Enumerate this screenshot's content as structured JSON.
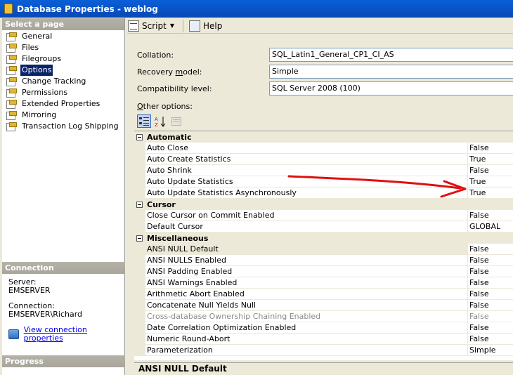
{
  "window": {
    "title": "Database Properties - weblog"
  },
  "left": {
    "select_page_heading": "Select a page",
    "pages": [
      {
        "label": "General",
        "name": "general"
      },
      {
        "label": "Files",
        "name": "files"
      },
      {
        "label": "Filegroups",
        "name": "filegroups"
      },
      {
        "label": "Options",
        "name": "options",
        "selected": true
      },
      {
        "label": "Change Tracking",
        "name": "change-tracking"
      },
      {
        "label": "Permissions",
        "name": "permissions"
      },
      {
        "label": "Extended Properties",
        "name": "extended-properties"
      },
      {
        "label": "Mirroring",
        "name": "mirroring"
      },
      {
        "label": "Transaction Log Shipping",
        "name": "transaction-log-shipping"
      }
    ],
    "connection_heading": "Connection",
    "server_label": "Server:",
    "server_value": "EMSERVER",
    "connection_label": "Connection:",
    "connection_value": "EMSERVER\\Richard",
    "view_connection_link": "View connection properties",
    "progress_heading": "Progress"
  },
  "toolbar": {
    "script_label": "Script",
    "help_label": "Help"
  },
  "form": {
    "collation_label": "Collation:",
    "collation_value": "SQL_Latin1_General_CP1_CI_AS",
    "recovery_label_pre": "Recovery ",
    "recovery_label_ul": "m",
    "recovery_label_post": "odel:",
    "recovery_value": "Simple",
    "compat_label": "Compatibility level:",
    "compat_value": "SQL Server 2008 (100)",
    "other_label_ul": "O",
    "other_label_post": "ther options:"
  },
  "grid": {
    "categories": [
      {
        "title": "Automatic",
        "rows": [
          {
            "name": "Auto Close",
            "value": "False"
          },
          {
            "name": "Auto Create Statistics",
            "value": "True"
          },
          {
            "name": "Auto Shrink",
            "value": "False"
          },
          {
            "name": "Auto Update Statistics",
            "value": "True"
          },
          {
            "name": "Auto Update Statistics Asynchronously",
            "value": "True"
          }
        ]
      },
      {
        "title": "Cursor",
        "rows": [
          {
            "name": "Close Cursor on Commit Enabled",
            "value": "False"
          },
          {
            "name": "Default Cursor",
            "value": "GLOBAL"
          }
        ]
      },
      {
        "title": "Miscellaneous",
        "rows": [
          {
            "name": "ANSI NULL Default",
            "value": "False",
            "selected": true
          },
          {
            "name": "ANSI NULLS Enabled",
            "value": "False"
          },
          {
            "name": "ANSI Padding Enabled",
            "value": "False"
          },
          {
            "name": "ANSI Warnings Enabled",
            "value": "False"
          },
          {
            "name": "Arithmetic Abort Enabled",
            "value": "False"
          },
          {
            "name": "Concatenate Null Yields Null",
            "value": "False"
          },
          {
            "name": "Cross-database Ownership Chaining Enabled",
            "value": "False",
            "grey": true
          },
          {
            "name": "Date Correlation Optimization Enabled",
            "value": "False"
          },
          {
            "name": "Numeric Round-Abort",
            "value": "False"
          },
          {
            "name": "Parameterization",
            "value": "Simple"
          }
        ]
      }
    ],
    "description_title": "ANSI NULL Default"
  },
  "colors": {
    "annotation_arrow": "#e01010",
    "selection": "#0a246a"
  }
}
